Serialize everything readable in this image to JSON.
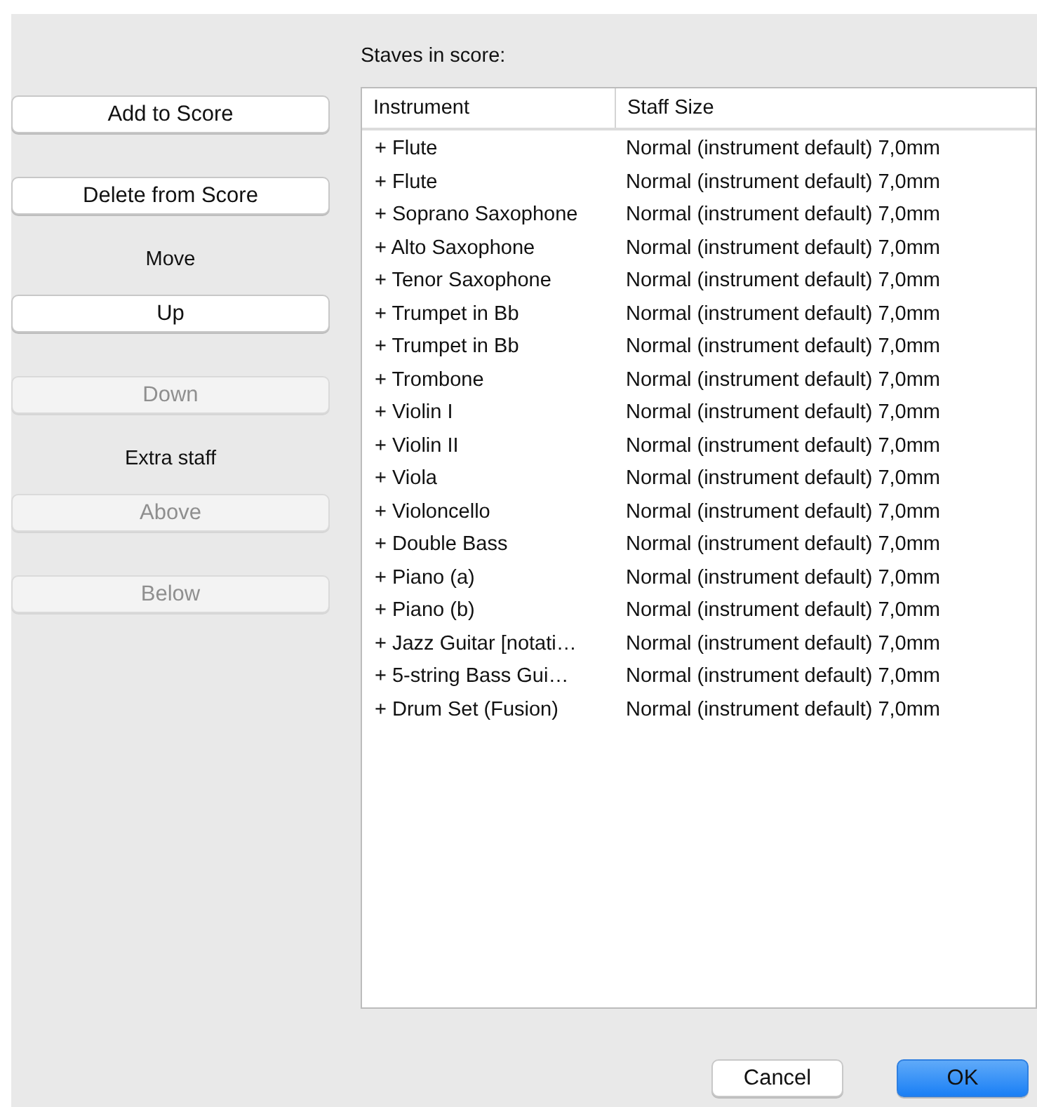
{
  "controls": [
    {
      "kind": "button",
      "label": "Add to Score",
      "disabled": false
    },
    {
      "kind": "button",
      "label": "Delete from Score",
      "disabled": false
    },
    {
      "kind": "label",
      "label": "Move"
    },
    {
      "kind": "button",
      "label": "Up",
      "disabled": false
    },
    {
      "kind": "button",
      "label": "Down",
      "disabled": true
    },
    {
      "kind": "label",
      "label": "Extra staff"
    },
    {
      "kind": "button",
      "label": "Above",
      "disabled": true
    },
    {
      "kind": "button",
      "label": "Below",
      "disabled": true
    }
  ],
  "staves_label": "Staves in score:",
  "table": {
    "columns": [
      "Instrument",
      "Staff Size"
    ],
    "rows": [
      {
        "instrument": "+ Flute",
        "staff_size": "Normal (instrument default) 7,0mm"
      },
      {
        "instrument": "+ Flute",
        "staff_size": "Normal (instrument default) 7,0mm"
      },
      {
        "instrument": "+ Soprano Saxophone",
        "staff_size": "Normal (instrument default) 7,0mm"
      },
      {
        "instrument": "+ Alto Saxophone",
        "staff_size": "Normal (instrument default) 7,0mm"
      },
      {
        "instrument": "+ Tenor Saxophone",
        "staff_size": "Normal (instrument default) 7,0mm"
      },
      {
        "instrument": "+ Trumpet in Bb",
        "staff_size": "Normal (instrument default) 7,0mm"
      },
      {
        "instrument": "+ Trumpet in Bb",
        "staff_size": "Normal (instrument default) 7,0mm"
      },
      {
        "instrument": "+ Trombone",
        "staff_size": "Normal (instrument default) 7,0mm"
      },
      {
        "instrument": "+ Violin I",
        "staff_size": "Normal (instrument default) 7,0mm"
      },
      {
        "instrument": "+ Violin II",
        "staff_size": "Normal (instrument default) 7,0mm"
      },
      {
        "instrument": "+ Viola",
        "staff_size": "Normal (instrument default) 7,0mm"
      },
      {
        "instrument": "+ Violoncello",
        "staff_size": "Normal (instrument default) 7,0mm"
      },
      {
        "instrument": "+ Double Bass",
        "staff_size": "Normal (instrument default) 7,0mm"
      },
      {
        "instrument": "+ Piano (a)",
        "staff_size": "Normal (instrument default) 7,0mm"
      },
      {
        "instrument": "+ Piano (b)",
        "staff_size": "Normal (instrument default) 7,0mm"
      },
      {
        "instrument": "+ Jazz Guitar [notati…",
        "staff_size": "Normal (instrument default) 7,0mm"
      },
      {
        "instrument": "+ 5-string Bass Gui…",
        "staff_size": "Normal (instrument default) 7,0mm"
      },
      {
        "instrument": "+ Drum Set (Fusion)",
        "staff_size": "Normal (instrument default) 7,0mm"
      }
    ]
  },
  "footer_buttons": [
    {
      "kind": "default",
      "label": "Cancel"
    },
    {
      "kind": "primary",
      "label": "OK"
    }
  ]
}
